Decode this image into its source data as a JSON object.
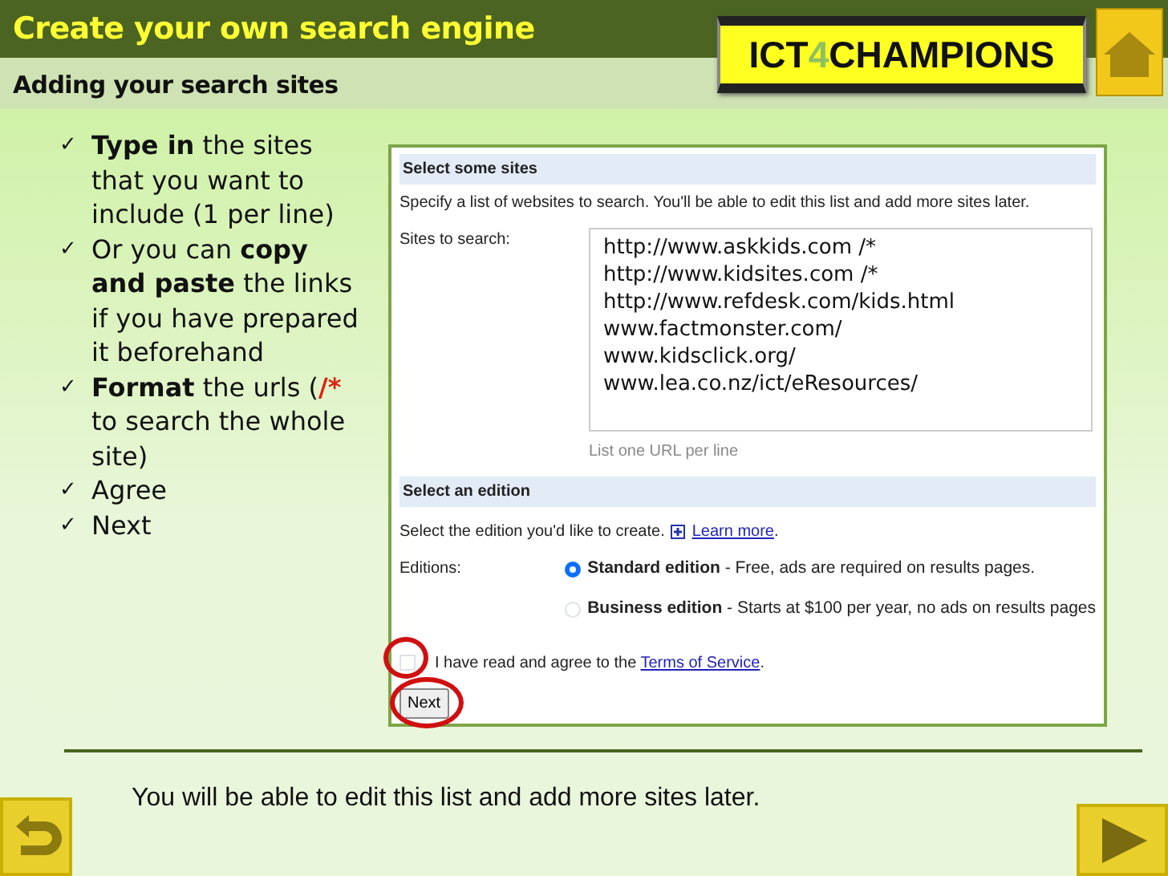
{
  "title": "Create your own search engine",
  "subtitle": "Adding your search sites",
  "logo": [
    {
      "text": "ICT",
      "accent": false
    },
    {
      "text": "4",
      "accent": true
    },
    {
      "text": "CHAMPIONS",
      "accent": false
    }
  ],
  "bullets": [
    {
      "marker": "✓",
      "parts": [
        {
          "text": "Type in",
          "bold": true,
          "red": false
        },
        {
          "text": " the sites that you want to include (1 per line)",
          "bold": false,
          "red": false
        }
      ]
    },
    {
      "marker": "✓",
      "parts": [
        {
          "text": "Or you can ",
          "bold": false,
          "red": false
        },
        {
          "text": "copy and paste",
          "bold": true,
          "red": false
        },
        {
          "text": " the links if you have prepared it beforehand",
          "bold": false,
          "red": false
        }
      ]
    },
    {
      "marker": "✓",
      "parts": [
        {
          "text": "Format",
          "bold": true,
          "red": false
        },
        {
          "text": " the urls (",
          "bold": false,
          "red": false
        },
        {
          "text": "/*",
          "bold": true,
          "red": true
        },
        {
          "text": " to search the whole site)",
          "bold": false,
          "red": false
        }
      ]
    },
    {
      "marker": "✓",
      "parts": [
        {
          "text": "Agree",
          "bold": false,
          "red": false
        }
      ]
    },
    {
      "marker": "✓",
      "parts": [
        {
          "text": "Next",
          "bold": false,
          "red": false
        }
      ]
    }
  ],
  "form": {
    "sites_header": "Select some sites",
    "sites_intro": "Specify a list of websites to search. You'll be able to edit this list and add more sites later.",
    "sites_label": "Sites to search:",
    "sites_value": [
      "http://www.askkids.com /*",
      "http://www.kidsites.com /*",
      "http://www.refdesk.com/kids.html",
      "www.factmonster.com/",
      "www.kidsclick.org/",
      "www.lea.co.nz/ict/eResources/"
    ],
    "sites_hint": "List one URL per line",
    "edition_header": "Select an edition",
    "edition_intro": "Select the edition you'd like to create.",
    "learn_more": "Learn more",
    "learn_more_after": ".",
    "editions_label": "Editions:",
    "editions": [
      {
        "name": "Standard edition",
        "desc": " - Free, ads are required on results pages.",
        "selected": true
      },
      {
        "name": "Business edition",
        "desc": " - Starts at $100 per year, no ads on results pages",
        "selected": false
      }
    ],
    "agree": {
      "checked": false,
      "highlighted": true,
      "text": "I have read and agree to the",
      "link": "Terms of Service",
      "after": "."
    },
    "next": {
      "label": "Next",
      "highlighted": true
    }
  },
  "footer": "You will be able to edit this list and add more sites later."
}
